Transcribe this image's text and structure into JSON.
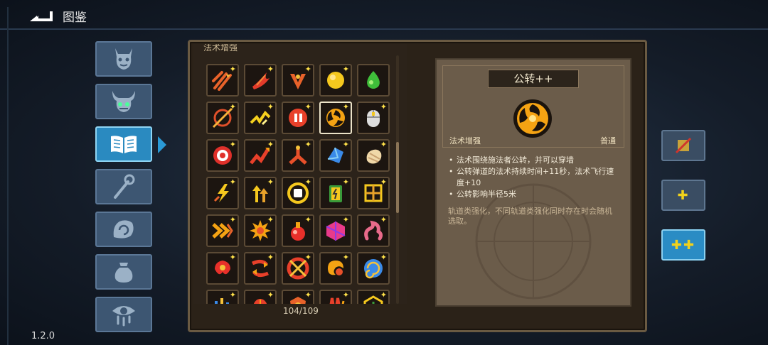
{
  "header": {
    "title": "图鉴",
    "back_icon": "back-icon"
  },
  "version": "1.2.0",
  "sidebar": {
    "tabs": [
      {
        "name": "tab-monsters",
        "icon": "demon-face-icon",
        "active": false
      },
      {
        "name": "tab-bosses",
        "icon": "horned-skull-icon",
        "active": false
      },
      {
        "name": "tab-codex",
        "icon": "open-book-icon",
        "active": true
      },
      {
        "name": "tab-staffs",
        "icon": "staff-icon",
        "active": false
      },
      {
        "name": "tab-relics",
        "icon": "hand-swirl-icon",
        "active": false
      },
      {
        "name": "tab-potions",
        "icon": "pouch-icon",
        "active": false
      },
      {
        "name": "tab-curses",
        "icon": "eye-drip-icon",
        "active": false
      }
    ]
  },
  "grid": {
    "category_header": "法术增强",
    "counter": "104/109",
    "icons": [
      "triple-arrow-icon",
      "claw-strike-icon",
      "fan-blades-icon",
      "gold-burst-icon",
      "green-drop-icon",
      "crosshair-orb-icon",
      "lightning-chain-icon",
      "pause-orb-icon",
      "orbit-swirl-icon",
      "mouse-icon",
      "target-icon",
      "zigzag-up-icon",
      "split-arrows-icon",
      "crystal-shards-icon",
      "larva-icon",
      "lightning-fist-icon",
      "up-arrows-icon",
      "dice-ring-icon",
      "battery-card-icon",
      "grid-cross-icon",
      "chevrons-right-icon",
      "spiky-sun-icon",
      "red-potion-icon",
      "rainbow-cube-icon",
      "worm-icon",
      "fire-flower-icon",
      "spin-arrows-icon",
      "fire-wheel-icon",
      "crescent-orb-icon",
      "galaxy-icon",
      "bars-icon",
      "beetle-icon",
      "shield-burst-icon",
      "triple-spike-icon",
      "hex-rune-icon"
    ],
    "selected_index": 8
  },
  "detail": {
    "name": "公转++",
    "category": "法术增强",
    "rarity": "普通",
    "icon": "orbit-swirl-icon",
    "bullets": [
      "法术围绕施法者公转，并可以穿墙",
      "公转弹道的法术持续时间+11秒，法术飞行速度+10",
      "公转影响半径5米"
    ],
    "note": "轨道类强化，不同轨道类强化同时存在时会随机选取。"
  },
  "right_buttons": [
    {
      "name": "no-upgrade-button",
      "label": "",
      "icon": "slash-icon",
      "active": false
    },
    {
      "name": "plus-button",
      "label": "✚",
      "active": false
    },
    {
      "name": "plus-plus-button",
      "label": "✚✚",
      "active": true
    }
  ],
  "colors": {
    "accent": "#2a8ac0",
    "panel": "#2b2218",
    "detail_bg": "#6b5c4a",
    "star": "#ffe14a"
  }
}
